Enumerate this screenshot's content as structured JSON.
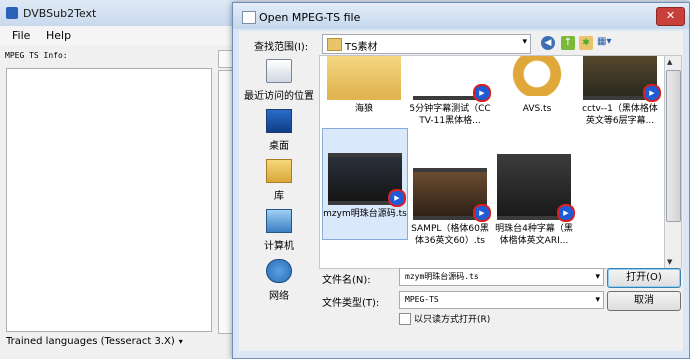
{
  "app": {
    "title": "DVBSub2Text",
    "menu": [
      "File",
      "Help"
    ],
    "info_label": "MPEG TS Info:",
    "status_text": "Trained languages (Tesseract 3.X)",
    "status_arrow": "▾"
  },
  "dialog": {
    "title": "Open MPEG-TS file",
    "close_label": "✕",
    "look_in_label": "查找范围(I):",
    "look_in_value": "TS素材",
    "places": [
      {
        "label": "最近访问的位置",
        "icon": "recent-places-icon"
      },
      {
        "label": "桌面",
        "icon": "desktop-icon"
      },
      {
        "label": "库",
        "icon": "library-icon"
      },
      {
        "label": "计算机",
        "icon": "computer-icon"
      },
      {
        "label": "网络",
        "icon": "network-icon"
      }
    ],
    "files": [
      {
        "name": "海狼",
        "icon": "folder-icon"
      },
      {
        "name": "5分钟字幕测试（CCTV-11黑体格...",
        "icon": "video-file-icon"
      },
      {
        "name": "AVS.ts",
        "icon": "media-file-icon"
      },
      {
        "name": "cctv--1（黑体格体英文等6层字幕...",
        "icon": "video-file-icon"
      },
      {
        "name": "mzym明珠台源码.ts",
        "icon": "video-file-icon",
        "selected": true
      },
      {
        "name": "SAMPL（格体60黑体36英文60）.ts",
        "icon": "video-file-icon"
      },
      {
        "name": "明珠台4种字幕（黑体楷体英文ARI...",
        "icon": "video-file-icon"
      }
    ],
    "file_name_label": "文件名(N):",
    "file_name_value": "mzym明珠台源码.ts",
    "file_type_label": "文件类型(T):",
    "file_type_value": "MPEG-TS",
    "readonly_label": "以只读方式打开(R)",
    "open_label": "打开(O)",
    "cancel_label": "取消"
  }
}
